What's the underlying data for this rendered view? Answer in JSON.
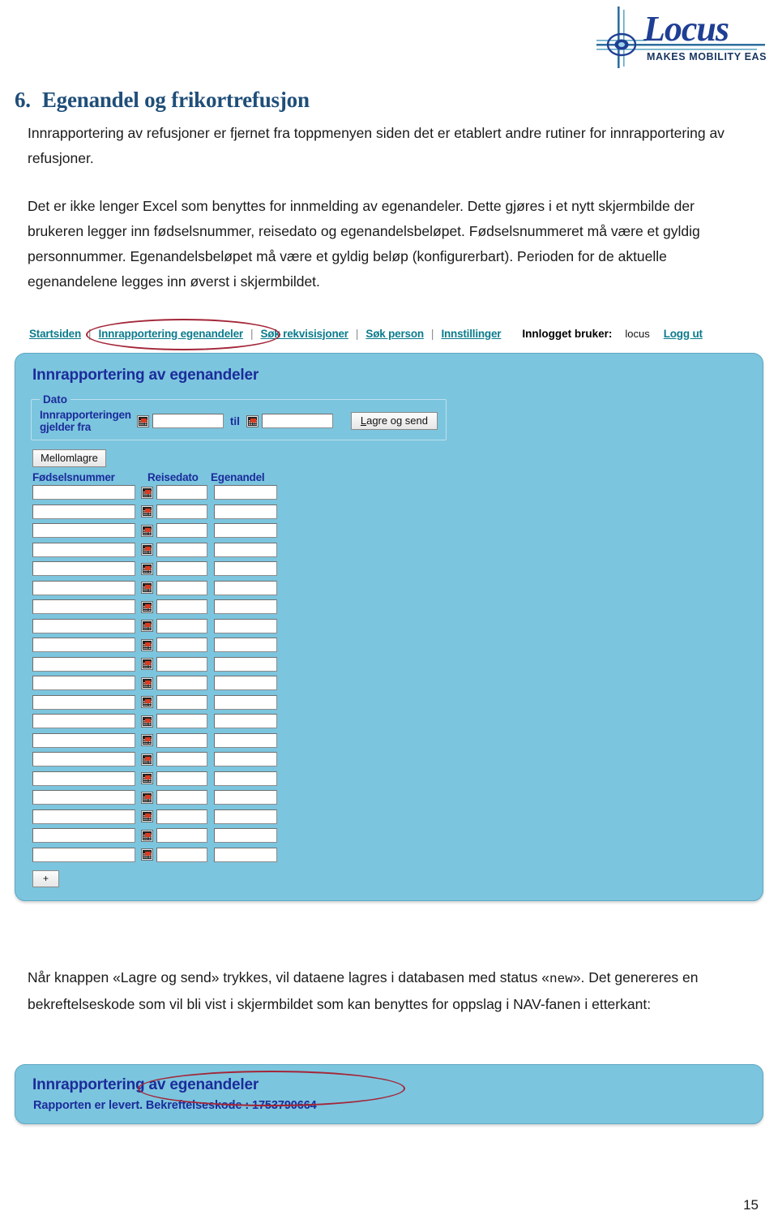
{
  "logo": {
    "wordmark": "Locus",
    "tagline": "MAKES MOBILITY EASY"
  },
  "document": {
    "section_number": "6.",
    "section_title": "Egenandel og frikortrefusjon",
    "paragraph_1": "Innrapportering av refusjoner er fjernet fra toppmenyen siden det er etablert andre rutiner for innrapportering av refusjoner.",
    "paragraph_2": "Det er ikke lenger Excel som benyttes for innmelding av egenandeler. Dette gjøres i et nytt skjermbilde der brukeren legger inn fødselsnummer, reisedato og egenandelsbeløpet. Fødselsnummeret må være et gyldig personnummer. Egenandelsbeløpet må være et gyldig beløp (konfigurerbart). Perioden for de aktuelle egenandelene legges inn øverst i skjermbildet.",
    "paragraph_3_part1": "Når knappen «Lagre og send» trykkes, vil dataene lagres i databasen med status «",
    "paragraph_3_mono": "new",
    "paragraph_3_part2": "». Det genereres en bekreftelseskode som vil bli vist i skjermbildet som kan benyttes for oppslag i NAV-fanen i etterkant:",
    "page_number": "15"
  },
  "app": {
    "nav": {
      "items": [
        {
          "label": "Startsiden"
        },
        {
          "label": "Innrapportering egenandeler"
        },
        {
          "label": "Søk rekvisisjoner"
        },
        {
          "label": "Søk person"
        },
        {
          "label": "Innstillinger"
        }
      ],
      "separator": "|",
      "user_label": "Innlogget bruker:",
      "user_name": "locus",
      "logout_label": "Logg ut"
    },
    "panel": {
      "title": "Innrapportering av egenandeler",
      "dato": {
        "legend": "Dato",
        "label_from": "Innrapporteringen gjelder fra",
        "label_to": "til",
        "from_value": "",
        "to_value": "",
        "from_placeholder": "",
        "to_placeholder": ""
      },
      "save_button": {
        "accesskey": "L",
        "rest": "agre og send"
      },
      "buffer_button": "Mellomlagre",
      "add_row_button": "+",
      "grid": {
        "columns": [
          "Fødselsnummer",
          "Reisedato",
          "Egenandel"
        ],
        "row_count": 20,
        "rows": [
          {
            "fodselsnummer": "",
            "reisedato": "",
            "egenandel": ""
          },
          {
            "fodselsnummer": "",
            "reisedato": "",
            "egenandel": ""
          },
          {
            "fodselsnummer": "",
            "reisedato": "",
            "egenandel": ""
          },
          {
            "fodselsnummer": "",
            "reisedato": "",
            "egenandel": ""
          },
          {
            "fodselsnummer": "",
            "reisedato": "",
            "egenandel": ""
          },
          {
            "fodselsnummer": "",
            "reisedato": "",
            "egenandel": ""
          },
          {
            "fodselsnummer": "",
            "reisedato": "",
            "egenandel": ""
          },
          {
            "fodselsnummer": "",
            "reisedato": "",
            "egenandel": ""
          },
          {
            "fodselsnummer": "",
            "reisedato": "",
            "egenandel": ""
          },
          {
            "fodselsnummer": "",
            "reisedato": "",
            "egenandel": ""
          },
          {
            "fodselsnummer": "",
            "reisedato": "",
            "egenandel": ""
          },
          {
            "fodselsnummer": "",
            "reisedato": "",
            "egenandel": ""
          },
          {
            "fodselsnummer": "",
            "reisedato": "",
            "egenandel": ""
          },
          {
            "fodselsnummer": "",
            "reisedato": "",
            "egenandel": ""
          },
          {
            "fodselsnummer": "",
            "reisedato": "",
            "egenandel": ""
          },
          {
            "fodselsnummer": "",
            "reisedato": "",
            "egenandel": ""
          },
          {
            "fodselsnummer": "",
            "reisedato": "",
            "egenandel": ""
          },
          {
            "fodselsnummer": "",
            "reisedato": "",
            "egenandel": ""
          },
          {
            "fodselsnummer": "",
            "reisedato": "",
            "egenandel": ""
          },
          {
            "fodselsnummer": "",
            "reisedato": "",
            "egenandel": ""
          }
        ]
      }
    },
    "confirmation": {
      "title": "Innrapportering av egenandeler",
      "message": "Rapporten er levert. Bekreftelseskode : 1753790664"
    }
  },
  "colors": {
    "panel_bg": "#7CC5DE",
    "panel_border": "#5FA8C4",
    "heading_blue": "#1F4E79",
    "app_heading_blue": "#1B2C9B",
    "link_teal": "#0B7B8C",
    "annotation_red": "#A32638",
    "logo_blue": "#1F3F94"
  }
}
